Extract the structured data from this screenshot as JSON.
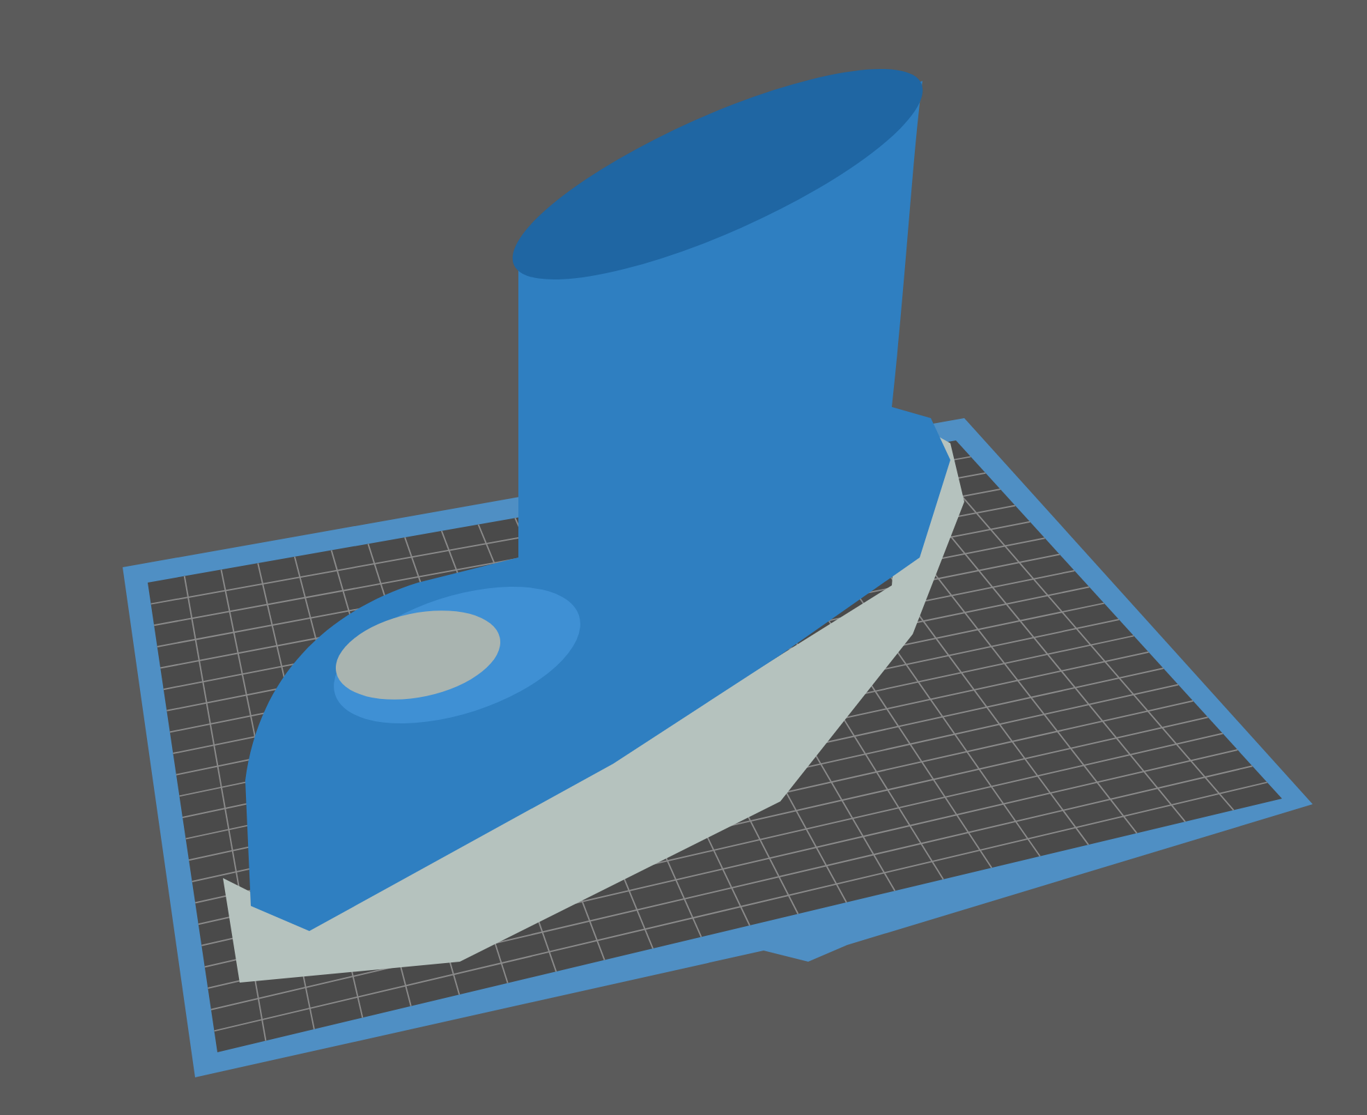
{
  "viewport": {
    "kind": "build-plate",
    "grid": true,
    "supports": true
  }
}
